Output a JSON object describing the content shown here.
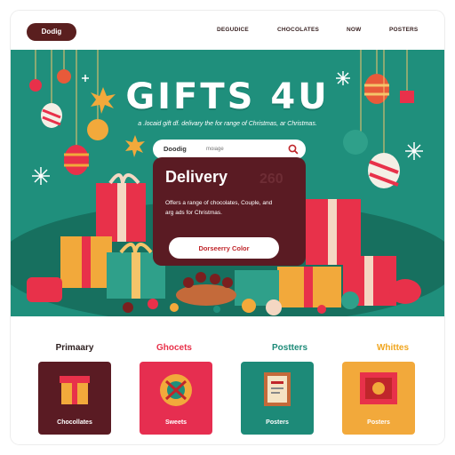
{
  "nav": {
    "logo": "Dodig",
    "links": [
      "DEGUDICE",
      "CHOCOLATES",
      "NOW",
      "POSTERS"
    ]
  },
  "hero": {
    "title": "GIFTS 4U",
    "subtitle": "a .locaid gift df. delivary the for range of Christmas, ar Christmas.",
    "search": {
      "label": "Doodig",
      "placeholder": "moiage"
    },
    "card": {
      "title": "Delivery",
      "ghost": "260",
      "description": "Offers a range of chocolates, Couple, and arg ads for Christmas.",
      "button": "Dorseerry Color"
    }
  },
  "categories": [
    {
      "heading": "Primaary",
      "tile_label": "Chocollates",
      "heading_color": "#2b1d1d",
      "tile_color": "#5a1b23"
    },
    {
      "heading": "Ghocets",
      "tile_label": "Sweets",
      "heading_color": "#e8314a",
      "tile_color": "#e62e50"
    },
    {
      "heading": "Postters",
      "tile_label": "Posters",
      "heading_color": "#1d8a78",
      "tile_color": "#1d8a78"
    },
    {
      "heading": "Whittes",
      "tile_label": "Posters",
      "heading_color": "#f0a51d",
      "tile_color": "#f2a93b"
    }
  ],
  "colors": {
    "hero_bg": "#1f8f7c",
    "card_bg": "#5a1b23",
    "button_text": "#c0262b"
  }
}
